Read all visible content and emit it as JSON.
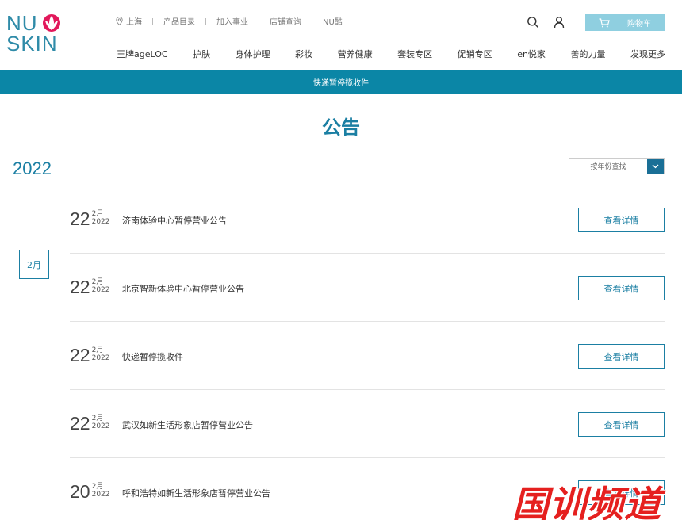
{
  "brand": {
    "line1": "NU",
    "line2": "SKIN",
    "logo_color": "#2f8ba8",
    "mark_color": "#e2185b"
  },
  "topbar": {
    "location": "上海",
    "links": [
      "产品目录",
      "加入事业",
      "店铺查询",
      "NU酷"
    ]
  },
  "header_icons": [
    "search-icon",
    "user-icon"
  ],
  "cart": {
    "label": "购物车",
    "color": "#8fcfe0"
  },
  "main_nav": [
    "王牌ageLOC",
    "护肤",
    "身体护理",
    "彩妆",
    "营养健康",
    "套装专区",
    "促销专区",
    "en悦家",
    "善的力量",
    "发现更多"
  ],
  "banner": {
    "text": "快递暂停揽收件",
    "color": "#0b86a6"
  },
  "page_title": "公告",
  "year": "2022",
  "year_select": {
    "placeholder": "按年份查找"
  },
  "month_marker": "2月",
  "notices": [
    {
      "day": "22",
      "month": "2月",
      "year": "2022",
      "title": "济南体验中心暂停营业公告",
      "button": "查看详情"
    },
    {
      "day": "22",
      "month": "2月",
      "year": "2022",
      "title": "北京智新体验中心暂停营业公告",
      "button": "查看详情"
    },
    {
      "day": "22",
      "month": "2月",
      "year": "2022",
      "title": "快递暂停揽收件",
      "button": "查看详情"
    },
    {
      "day": "22",
      "month": "2月",
      "year": "2022",
      "title": "武汉如新生活形象店暂停营业公告",
      "button": "查看详情"
    },
    {
      "day": "20",
      "month": "2月",
      "year": "2022",
      "title": "呼和浩特如新生活形象店暂停营业公告",
      "button": "查看详情"
    }
  ],
  "watermark": {
    "text": "国训频道",
    "color": "#e5201f"
  },
  "accent_color": "#1b7fa3"
}
